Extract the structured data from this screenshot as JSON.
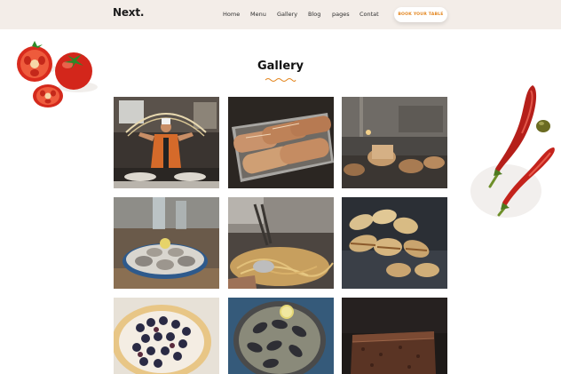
{
  "header": {
    "logo": "Next.",
    "nav": [
      "Home",
      "Menu",
      "Gallery",
      "Blog",
      "pages",
      "Contat"
    ],
    "cta": "BOOK YOUR TABLE"
  },
  "gallery": {
    "title": "Gallery",
    "images": [
      "chef-noodles-photo",
      "baked-bread-tray-photo",
      "bakery-counter-photo",
      "oysters-platter-photo",
      "pasta-tossing-photo",
      "pastries-sugar-photo",
      "berry-tart-photo",
      "mussels-pan-photo",
      "brownie-photo"
    ]
  },
  "decorations": [
    "tomatoes-icon",
    "red-chili-peppers-icon"
  ],
  "colors": {
    "header_bg": "#f3ede8",
    "accent": "#e3861f",
    "text": "#1c1c1c"
  }
}
